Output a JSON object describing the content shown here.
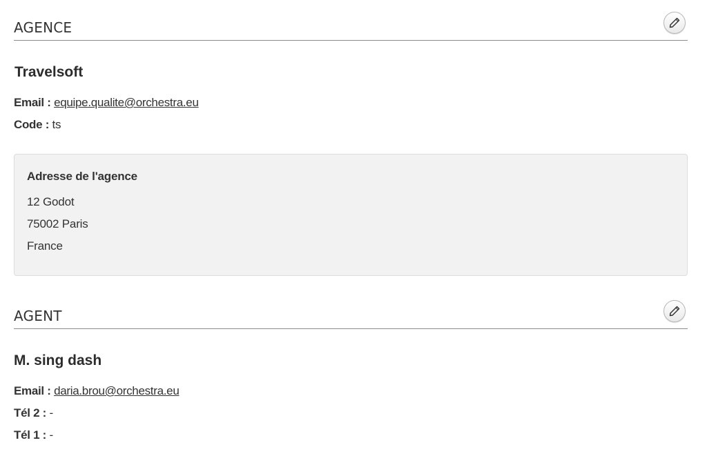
{
  "agence": {
    "section_title": "AGENCE",
    "edit_icon": "pencil-icon",
    "name": "Travelsoft",
    "email_label": "Email :",
    "email_value": "equipe.qualite@orchestra.eu",
    "code_label": "Code :",
    "code_value": "ts",
    "address": {
      "title": "Adresse de l'agence",
      "line1": "12 Godot",
      "line2": "75002 Paris",
      "line3": "France"
    }
  },
  "agent": {
    "section_title": "AGENT",
    "edit_icon": "pencil-icon",
    "name": "M. sing dash",
    "email_label": "Email :",
    "email_value": "daria.brou@orchestra.eu",
    "tel2_label": "Tél 2 :",
    "tel2_value": "-",
    "tel1_label": "Tél 1 :",
    "tel1_value": "-"
  },
  "colors": {
    "divider": "#8a8a8a",
    "address_bg": "#f2f2f2",
    "text": "#333333"
  }
}
